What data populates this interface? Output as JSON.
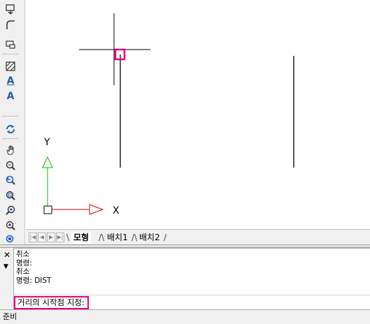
{
  "toolbar": {
    "tools": [
      {
        "icon": "rectangle-arrow-icon"
      },
      {
        "icon": "fillet-icon"
      },
      {
        "icon": "insert-block-icon"
      },
      {
        "icon": "hatch-icon"
      },
      {
        "icon": "multiline-text-icon",
        "glyph": "A"
      },
      {
        "icon": "single-line-text-icon",
        "glyph": "A"
      },
      {
        "icon": "regen-icon"
      },
      {
        "icon": "pan-hand-icon"
      },
      {
        "icon": "zoom-realtime-icon"
      },
      {
        "icon": "zoom-previous-icon"
      },
      {
        "icon": "zoom-window-icon"
      },
      {
        "icon": "zoom-dynamic-icon"
      },
      {
        "icon": "zoom-in-icon"
      },
      {
        "icon": "zoom-extents-icon"
      }
    ]
  },
  "canvas": {
    "ucs_y_label": "Y",
    "ucs_x_label": "X",
    "crosshair_color": "#000000",
    "pickbox_color": "#e6007e",
    "ucs_y_color": "#00c000",
    "ucs_x_color": "#e00000"
  },
  "layout_tabs": {
    "nav_buttons": [
      "|◀",
      "◀",
      "▶",
      "▶|"
    ],
    "tabs": [
      {
        "label": "모형",
        "active": true
      },
      {
        "label": "배치1",
        "active": false
      },
      {
        "label": "배치2",
        "active": false
      }
    ]
  },
  "command": {
    "close_glyph": "✕",
    "menu_glyph": "▼",
    "history": [
      "취소",
      "명령:",
      "취소",
      "명령: DIST"
    ],
    "prompt": "거리의 시작점 지정:",
    "highlight_color": "#e6007e"
  },
  "status": {
    "text": "준비"
  }
}
